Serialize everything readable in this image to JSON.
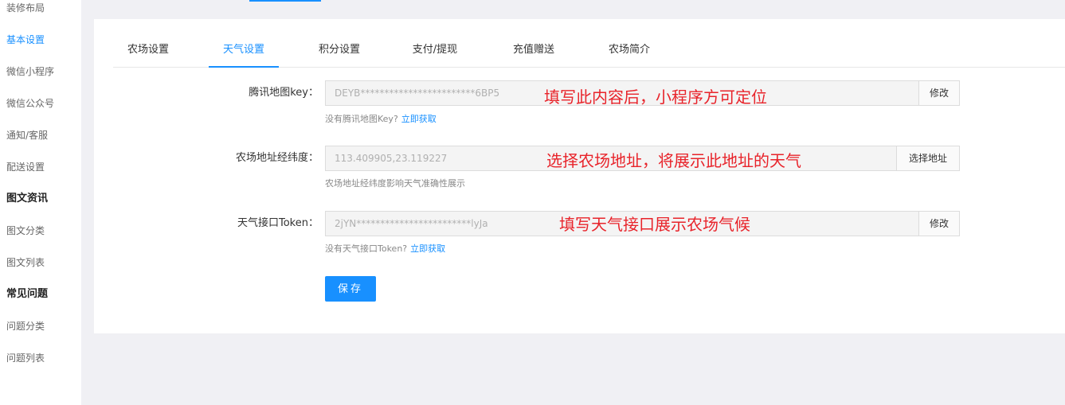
{
  "sidebar": {
    "items": [
      {
        "label": "装修布局"
      },
      {
        "label": "基本设置"
      },
      {
        "label": "微信小程序"
      },
      {
        "label": "微信公众号"
      },
      {
        "label": "通知/客服"
      },
      {
        "label": "配送设置"
      }
    ],
    "section_news": "图文资讯",
    "news_items": [
      {
        "label": "图文分类"
      },
      {
        "label": "图文列表"
      }
    ],
    "section_faq": "常见问题",
    "faq_items": [
      {
        "label": "问题分类"
      },
      {
        "label": "问题列表"
      }
    ],
    "active_item": "基本设置"
  },
  "tabs": [
    {
      "label": "农场设置"
    },
    {
      "label": "天气设置"
    },
    {
      "label": "积分设置"
    },
    {
      "label": "支付/提现"
    },
    {
      "label": "充值赠送"
    },
    {
      "label": "农场简介"
    }
  ],
  "active_tab": "天气设置",
  "form": {
    "map_key": {
      "label": "腾讯地图key：",
      "value": "DEYB************************6BP5",
      "button": "修改",
      "help_text": "没有腾讯地图Key?",
      "help_link": "立即获取",
      "annotation": "填写此内容后，小程序方可定位"
    },
    "coordinates": {
      "label": "农场地址经纬度：",
      "value": "113.409905,23.119227",
      "button": "选择地址",
      "help_text": "农场地址经纬度影响天气准确性展示",
      "annotation": "选择农场地址，将展示此地址的天气"
    },
    "weather_token": {
      "label": "天气接口Token：",
      "value": "2jYN************************lyJa",
      "button": "修改",
      "help_text": "没有天气接口Token?",
      "help_link": "立即获取",
      "annotation": "填写天气接口展示农场气候"
    },
    "save_label": "保存"
  },
  "colors": {
    "accent": "#1890ff",
    "annotation": "#e8232a",
    "page_bg": "#f0f0f4"
  }
}
